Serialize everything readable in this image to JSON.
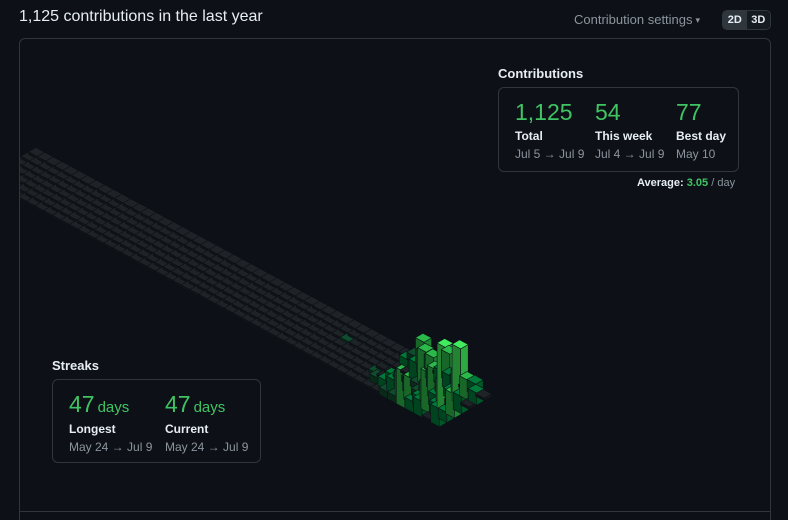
{
  "header": {
    "title": "1,125 contributions in the last year",
    "settings_label": "Contribution settings",
    "view_toggle": {
      "options": [
        "2D",
        "3D"
      ],
      "selected": "3D"
    }
  },
  "contributions": {
    "title": "Contributions",
    "stats": [
      {
        "value": "1,125",
        "label": "Total",
        "range": "Jul 5 → Jul 9"
      },
      {
        "value": "54",
        "label": "This week",
        "range": "Jul 4 → Jul 9"
      },
      {
        "value": "77",
        "label": "Best day",
        "range": "May 10"
      }
    ],
    "average": {
      "label": "Average:",
      "value": "3.05",
      "unit": "/ day"
    }
  },
  "streaks": {
    "title": "Streaks",
    "stats": [
      {
        "value": "47",
        "unit": "days",
        "label": "Longest",
        "range": "May 24 → Jul 9"
      },
      {
        "value": "47",
        "unit": "days",
        "label": "Current",
        "range": "May 24 → Jul 9"
      }
    ]
  },
  "colors": {
    "empty_tile": "#1b1f23",
    "level_1": "#0e4429",
    "level_2": "#006d32",
    "level_3": "#26a641",
    "level_4": "#39d353",
    "accent": "#40c463"
  }
}
